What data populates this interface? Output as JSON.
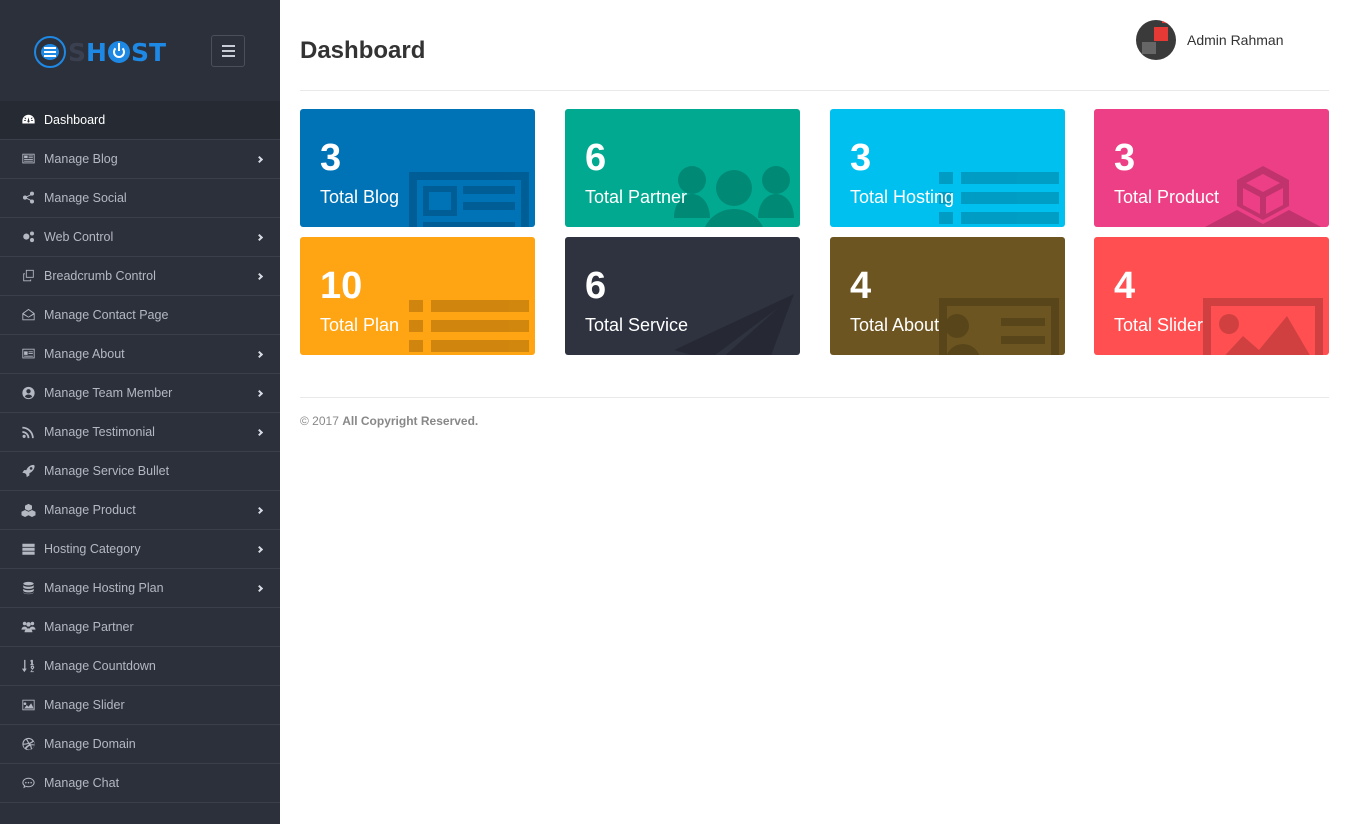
{
  "brand": {
    "logo_letters": [
      "S",
      "H",
      "ST"
    ],
    "logo_accent": "#1e88e5"
  },
  "sidebar": {
    "items": [
      {
        "label": "Dashboard",
        "icon": "dashboard-icon",
        "has_children": false,
        "active": true
      },
      {
        "label": "Manage Blog",
        "icon": "newspaper-icon",
        "has_children": true
      },
      {
        "label": "Manage Social",
        "icon": "share-icon",
        "has_children": false
      },
      {
        "label": "Web Control",
        "icon": "gears-icon",
        "has_children": true
      },
      {
        "label": "Breadcrumb Control",
        "icon": "clone-icon",
        "has_children": true
      },
      {
        "label": "Manage Contact Page",
        "icon": "envelope-open-icon",
        "has_children": false
      },
      {
        "label": "Manage About",
        "icon": "id-card-icon",
        "has_children": true
      },
      {
        "label": "Manage Team Member",
        "icon": "user-circle-icon",
        "has_children": true
      },
      {
        "label": "Manage Testimonial",
        "icon": "rss-icon",
        "has_children": true
      },
      {
        "label": "Manage Service Bullet",
        "icon": "rocket-icon",
        "has_children": false
      },
      {
        "label": "Manage Product",
        "icon": "cubes-icon",
        "has_children": true
      },
      {
        "label": "Hosting Category",
        "icon": "server-icon",
        "has_children": true
      },
      {
        "label": "Manage Hosting Plan",
        "icon": "database-icon",
        "has_children": true
      },
      {
        "label": "Manage Partner",
        "icon": "users-icon",
        "has_children": false
      },
      {
        "label": "Manage Countdown",
        "icon": "sort-numeric-icon",
        "has_children": false
      },
      {
        "label": "Manage Slider",
        "icon": "image-icon",
        "has_children": false
      },
      {
        "label": "Manage Domain",
        "icon": "dribbble-icon",
        "has_children": false
      },
      {
        "label": "Manage Chat",
        "icon": "comment-dots-icon",
        "has_children": false
      }
    ]
  },
  "header": {
    "title": "Dashboard",
    "user_name": "Admin Rahman"
  },
  "cards": [
    {
      "value": "3",
      "label": "Total Blog",
      "color": "#0073b7",
      "icon": "newspaper-icon"
    },
    {
      "value": "6",
      "label": "Total Partner",
      "color": "#00a990",
      "icon": "users-icon"
    },
    {
      "value": "3",
      "label": "Total Hosting",
      "color": "#00c0ef",
      "icon": "list-icon"
    },
    {
      "value": "3",
      "label": "Total Product",
      "color": "#ec3f85",
      "icon": "cube-icon"
    },
    {
      "value": "10",
      "label": "Total Plan",
      "color": "#ffa412",
      "icon": "list-icon"
    },
    {
      "value": "6",
      "label": "Total Service",
      "color": "#2f3340",
      "icon": "paper-plane-icon"
    },
    {
      "value": "4",
      "label": "Total About",
      "color": "#6c5520",
      "icon": "id-card-icon"
    },
    {
      "value": "4",
      "label": "Total Slider",
      "color": "#ff4f50",
      "icon": "image-icon"
    }
  ],
  "footer": {
    "year": "© 2017",
    "text": "All Copyright Reserved."
  }
}
